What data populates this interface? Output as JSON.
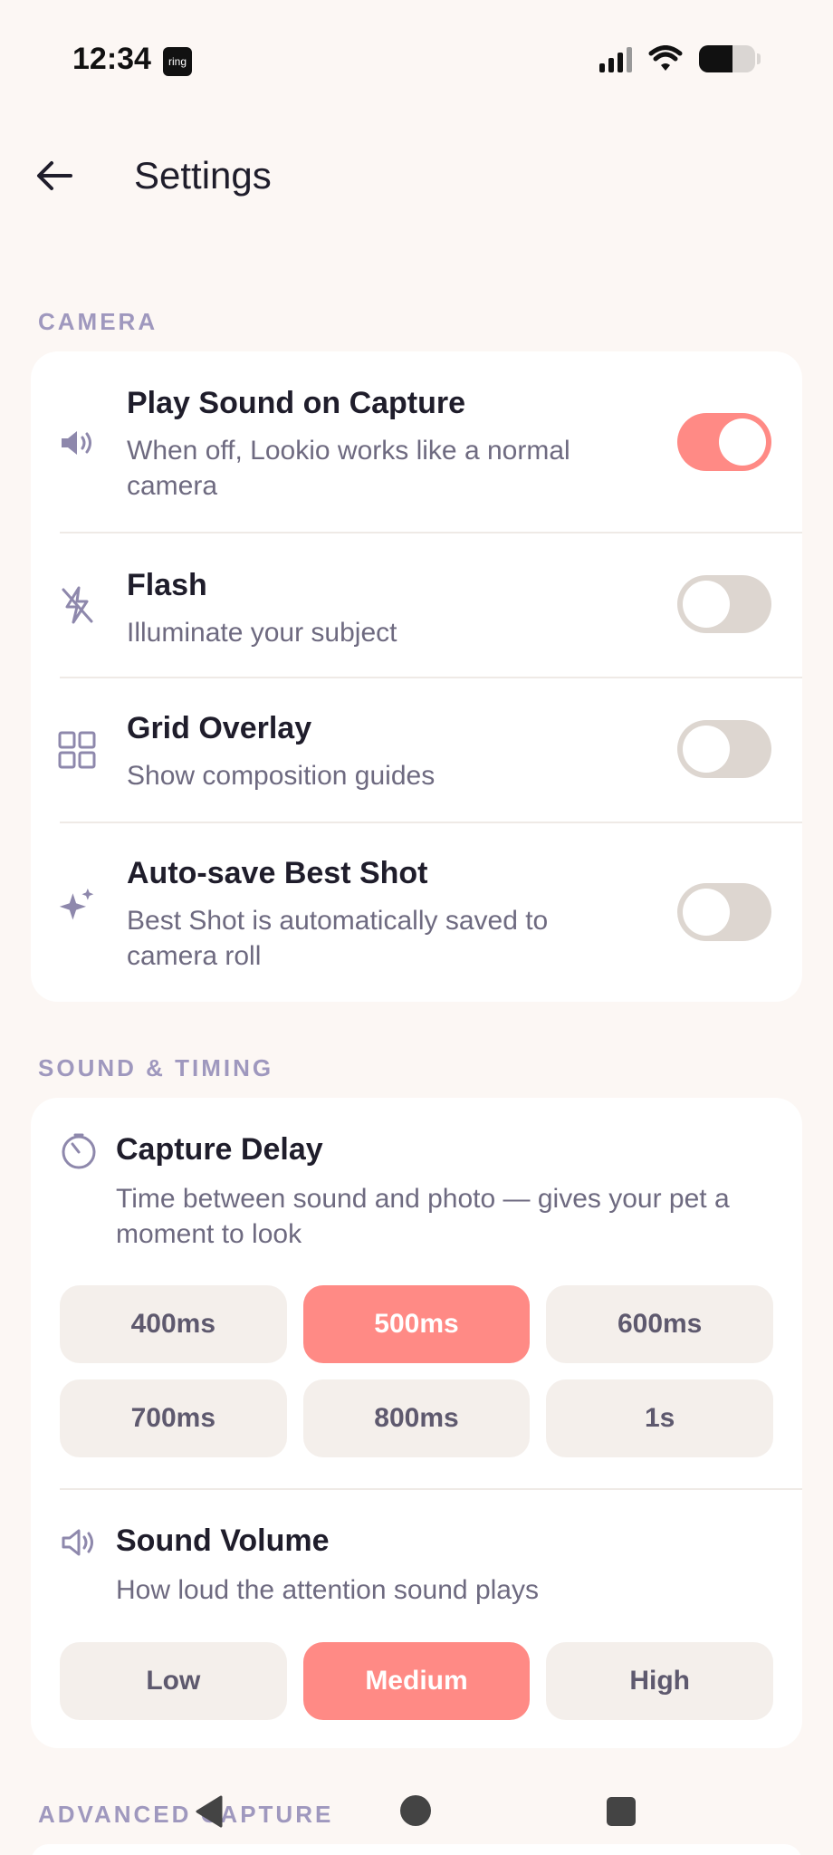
{
  "status_bar": {
    "time": "12:34",
    "ring_badge": "ring"
  },
  "header": {
    "title": "Settings"
  },
  "sections": {
    "camera": {
      "label": "CAMERA",
      "rows": [
        {
          "title": "Play Sound on Capture",
          "subtitle": "When off, Lookio works like a normal camera",
          "icon": "speaker-icon",
          "enabled": true
        },
        {
          "title": "Flash",
          "subtitle": "Illuminate your subject",
          "icon": "flash-off-icon",
          "enabled": false
        },
        {
          "title": "Grid Overlay",
          "subtitle": "Show composition guides",
          "icon": "grid-icon",
          "enabled": false
        },
        {
          "title": "Auto-save Best Shot",
          "subtitle": "Best Shot is automatically saved to camera roll",
          "icon": "sparkles-icon",
          "enabled": false
        }
      ]
    },
    "sound_timing": {
      "label": "SOUND & TIMING",
      "capture_delay": {
        "title": "Capture Delay",
        "description": "Time between sound and photo — gives your pet a moment to look",
        "options": [
          "400ms",
          "500ms",
          "600ms",
          "700ms",
          "800ms",
          "1s"
        ],
        "selected": "500ms"
      },
      "sound_volume": {
        "title": "Sound Volume",
        "description": "How loud the attention sound plays",
        "options": [
          "Low",
          "Medium",
          "High"
        ],
        "selected": "Medium"
      }
    },
    "advanced_capture": {
      "label": "ADVANCED CAPTURE"
    }
  },
  "colors": {
    "accent": "#FF8A85",
    "background": "#FCF7F4",
    "section_label": "#9F98BE"
  }
}
